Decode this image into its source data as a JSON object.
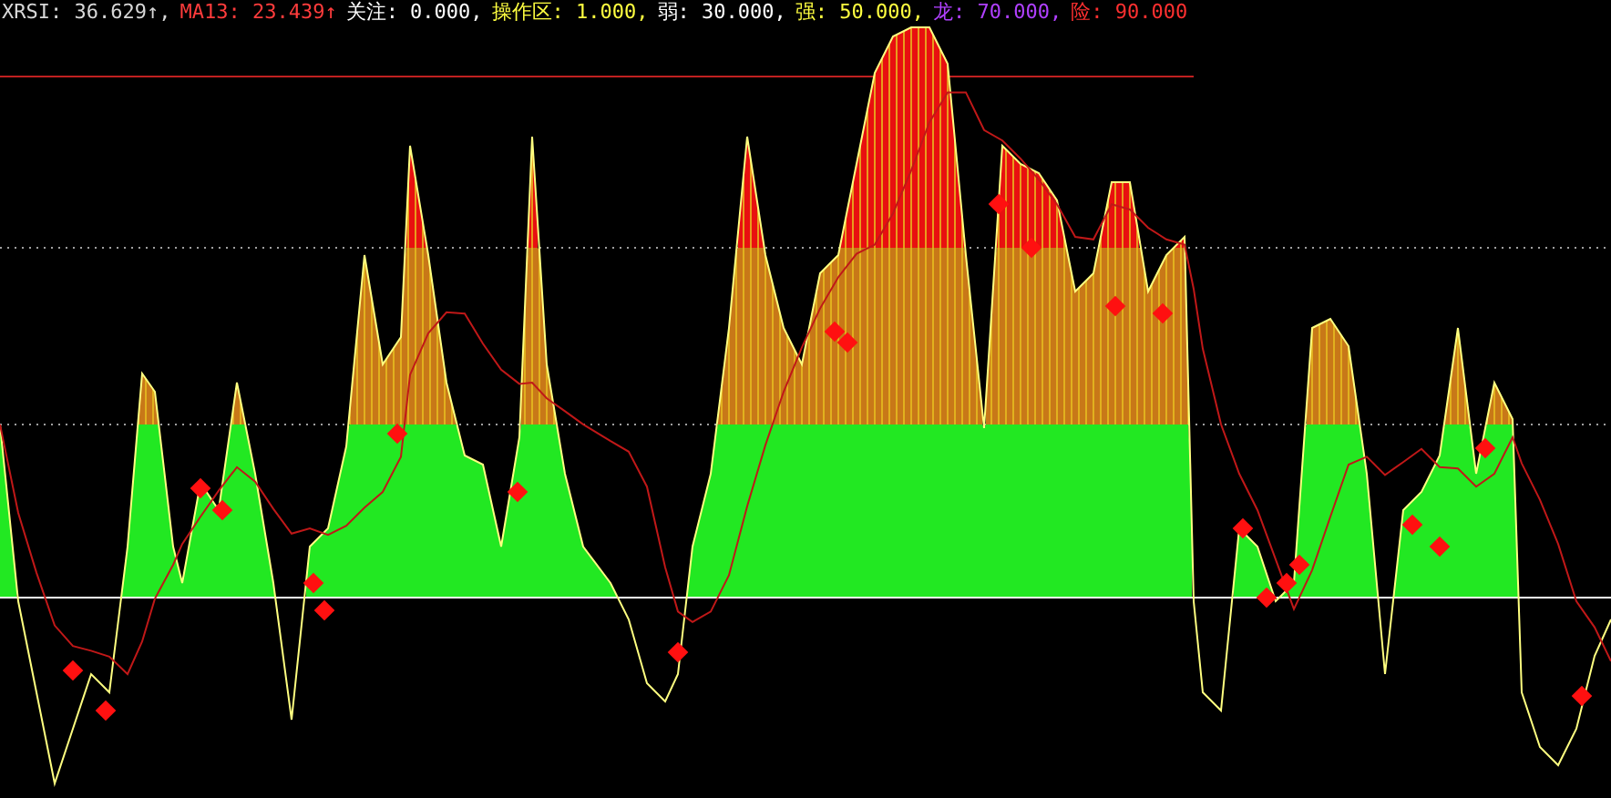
{
  "indicator_header": [
    {
      "text": "XRSI: 36.629↑,",
      "color": "#d8d8d8"
    },
    {
      "text": "MA13: 23.439↑",
      "color": "#ff3c3c"
    },
    {
      "text": "关注: 0.000,",
      "color": "#ffffff"
    },
    {
      "text": "操作区: 1.000,",
      "color": "#ffff40"
    },
    {
      "text": "弱: 30.000,",
      "color": "#ffffff"
    },
    {
      "text": "强: 50.000,",
      "color": "#ffff40"
    },
    {
      "text": "龙: 70.000,",
      "color": "#b040ff"
    },
    {
      "text": "险: 90.000",
      "color": "#ff3030"
    }
  ]
}
